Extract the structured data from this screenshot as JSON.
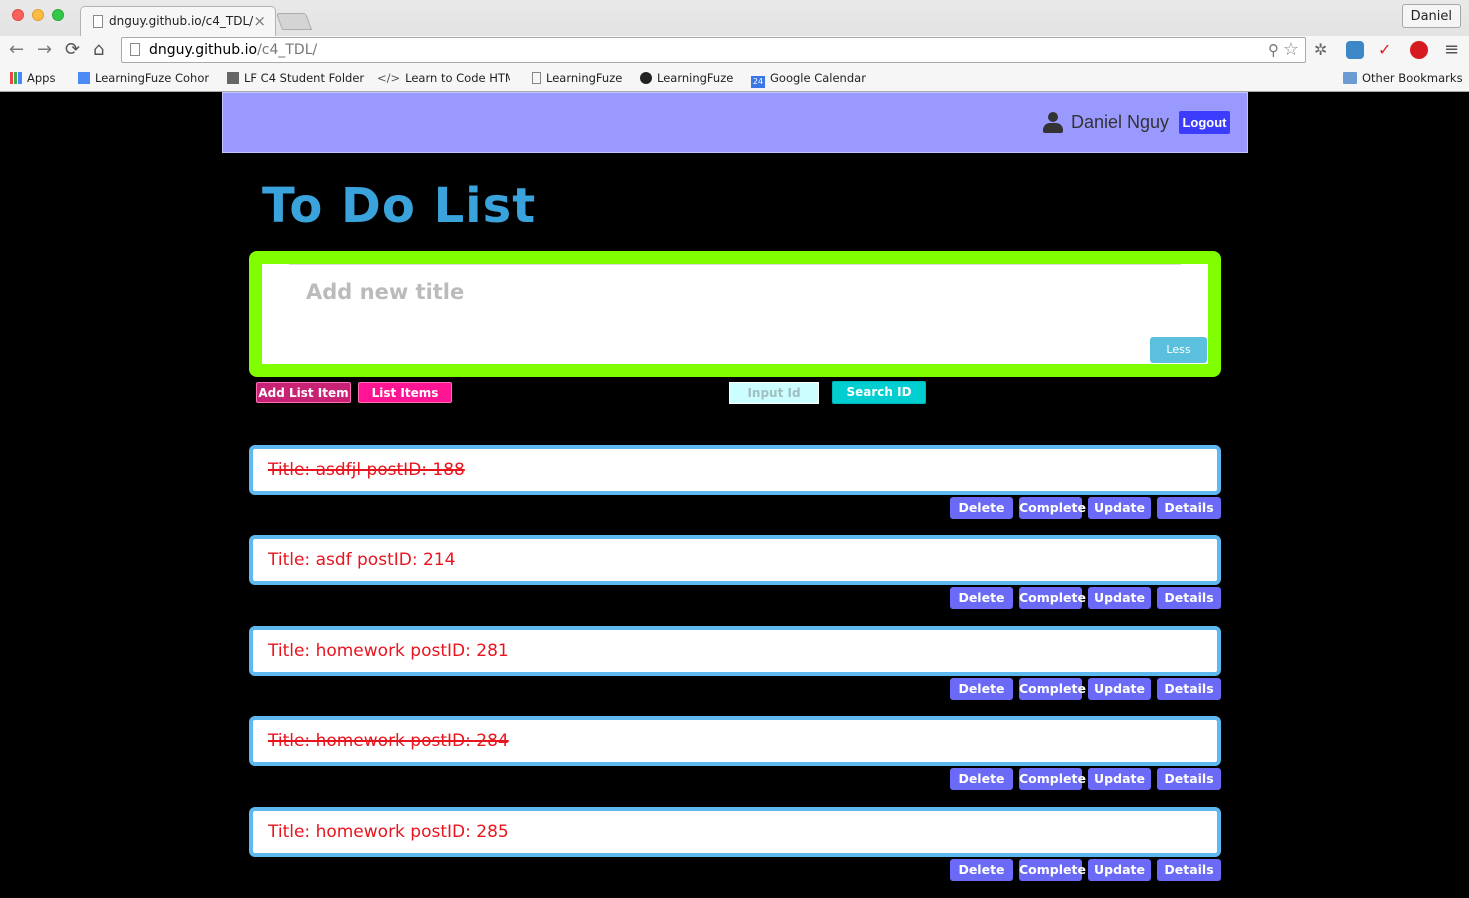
{
  "browser": {
    "tab_title": "dnguy.github.io/c4_TDL/",
    "profile_label": "Daniel",
    "url_host": "dnguy.github.io",
    "url_path": "/c4_TDL/",
    "bookmarks": [
      "Apps",
      "LearningFuze Cohort",
      "LF C4 Student Folder",
      "Learn to Code HTML",
      "LearningFuze",
      "LearningFuze",
      "Google Calendar",
      "Other Bookmarks"
    ],
    "calendar_day": "24"
  },
  "header": {
    "user_name": "Daniel Nguy",
    "logout_label": "Logout"
  },
  "page_title": "To Do List",
  "form": {
    "title_placeholder": "Add new title",
    "less_label": "Less"
  },
  "controls": {
    "add_list_item_label": "Add List Item",
    "list_items_label": "List Items",
    "input_id_placeholder": "Input Id",
    "search_id_label": "Search ID"
  },
  "actions": {
    "delete": "Delete",
    "complete": "Complete",
    "update": "Update",
    "details": "Details"
  },
  "items": [
    {
      "text": "Title: asdfjl postID: 188",
      "completed": true
    },
    {
      "text": "Title: asdf postID: 214",
      "completed": false
    },
    {
      "text": "Title: homework postID: 281",
      "completed": false
    },
    {
      "text": "Title: homework postID: 284",
      "completed": true
    },
    {
      "text": "Title: homework postID: 285",
      "completed": false
    }
  ],
  "colors": {
    "header_bg": "#9999ff",
    "title": "#3aa3db",
    "form_border": "#80ff00",
    "item_border": "#5fb8f0",
    "item_text": "#e8141e",
    "action_button": "#6a6af6"
  }
}
